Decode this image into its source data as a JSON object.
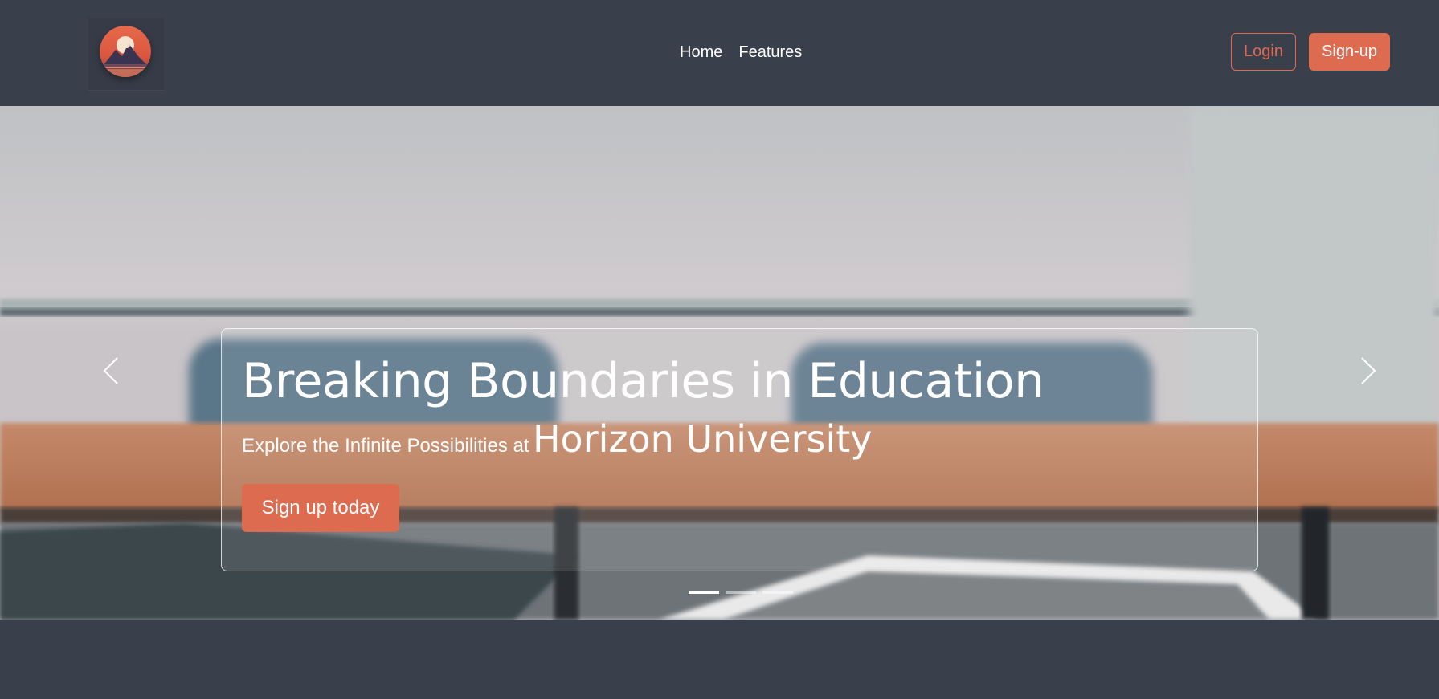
{
  "nav": {
    "links": [
      {
        "label": "Home"
      },
      {
        "label": "Features"
      }
    ],
    "login_label": "Login",
    "signup_label": "Sign-up"
  },
  "hero": {
    "title": "Breaking Boundaries in Education",
    "subtitle_prefix": "Explore the Infinite Possibilities at",
    "subtitle_highlight": "Horizon University",
    "cta_label": "Sign up today",
    "slide_count": 3,
    "active_slide": 1
  },
  "icons": {
    "logo": "mountain-logo-icon",
    "prev": "chevron-left-icon",
    "next": "chevron-right-icon"
  },
  "colors": {
    "background": "#3a3f4c",
    "accent": "#dd6b50",
    "text": "#ffffff"
  }
}
